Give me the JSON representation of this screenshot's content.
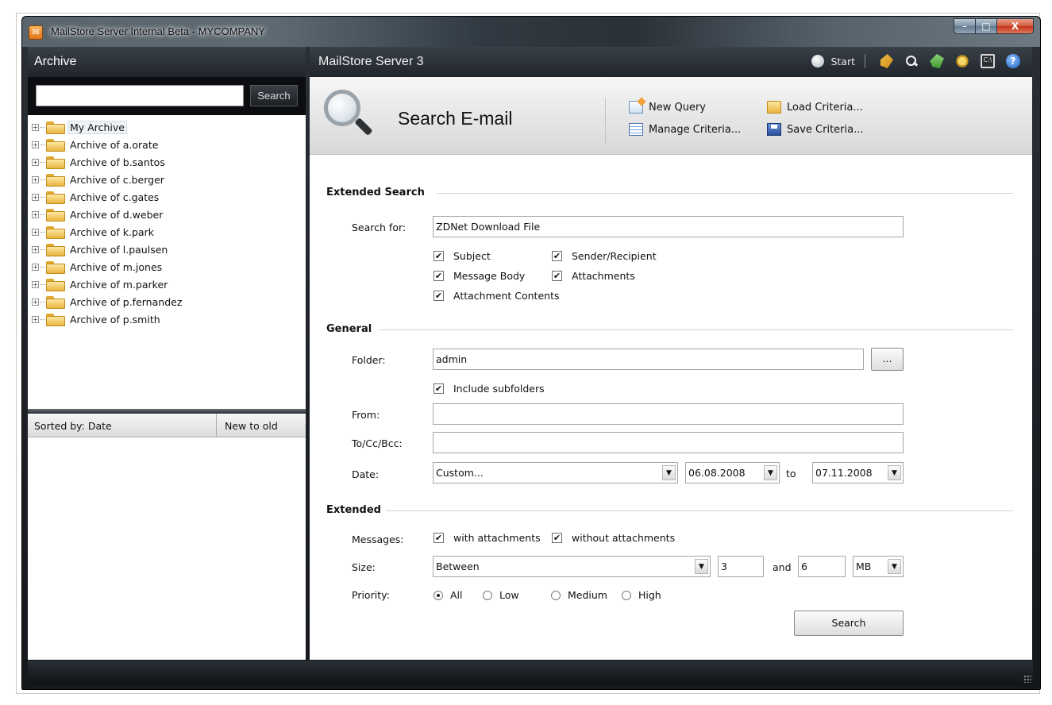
{
  "window": {
    "title": "MailStore Server Internal Beta - MYCOMPANY",
    "minimize": "–",
    "maximize": "□",
    "close": "X"
  },
  "left": {
    "header": "Archive",
    "search_button": "Search",
    "search_value": "",
    "tree": [
      {
        "label": "My Archive",
        "selected": true
      },
      {
        "label": "Archive of a.orate"
      },
      {
        "label": "Archive of b.santos"
      },
      {
        "label": "Archive of c.berger"
      },
      {
        "label": "Archive of c.gates"
      },
      {
        "label": "Archive of d.weber"
      },
      {
        "label": "Archive of k.park"
      },
      {
        "label": "Archive of l.paulsen"
      },
      {
        "label": "Archive of m.jones"
      },
      {
        "label": "Archive of m.parker"
      },
      {
        "label": "Archive of p.fernandez"
      },
      {
        "label": "Archive of p.smith"
      }
    ],
    "expander": "+",
    "sorted_by": "Sorted by: Date",
    "sort_order": "New to old"
  },
  "right": {
    "header": "MailStore Server 3",
    "start_label": "Start",
    "cmd_icon_text": "C:\\",
    "help_icon_text": "?",
    "banner_title": "Search E-mail",
    "actions": {
      "new_query": "New Query",
      "manage_criteria": "Manage Criteria...",
      "load_criteria": "Load Criteria...",
      "save_criteria": "Save Criteria..."
    }
  },
  "form": {
    "extended_search_title": "Extended Search",
    "search_for_label": "Search for:",
    "search_for_value": "ZDNet Download File",
    "checks": {
      "subject": {
        "label": "Subject",
        "checked": true
      },
      "sender_recipient": {
        "label": "Sender/Recipient",
        "checked": true
      },
      "message_body": {
        "label": "Message Body",
        "checked": true
      },
      "attachments": {
        "label": "Attachments",
        "checked": true
      },
      "attachment_contents": {
        "label": "Attachment Contents",
        "checked": true
      }
    },
    "check_mark": "✔",
    "general_title": "General",
    "folder_label": "Folder:",
    "folder_value": "admin",
    "browse_button": "...",
    "include_subfolders": {
      "label": "Include subfolders",
      "checked": true
    },
    "from_label": "From:",
    "from_value": "",
    "to_label": "To/Cc/Bcc:",
    "to_value": "",
    "date_label": "Date:",
    "date_mode": "Custom...",
    "date_from": "06.08.2008",
    "date_to_word": "to",
    "date_to": "07.11.2008",
    "dropdown_arrow": "▼",
    "extended_title": "Extended",
    "messages_label": "Messages:",
    "with_attachments": {
      "label": "with attachments",
      "checked": true
    },
    "without_attachments": {
      "label": "without attachments",
      "checked": true
    },
    "size_label": "Size:",
    "size_mode": "Between",
    "size_min": "3",
    "size_and": "and",
    "size_max": "6",
    "size_unit": "MB",
    "priority_label": "Priority:",
    "priority_options": [
      "All",
      "Low",
      "Medium",
      "High"
    ],
    "priority_selected": "All",
    "search_button": "Search"
  }
}
